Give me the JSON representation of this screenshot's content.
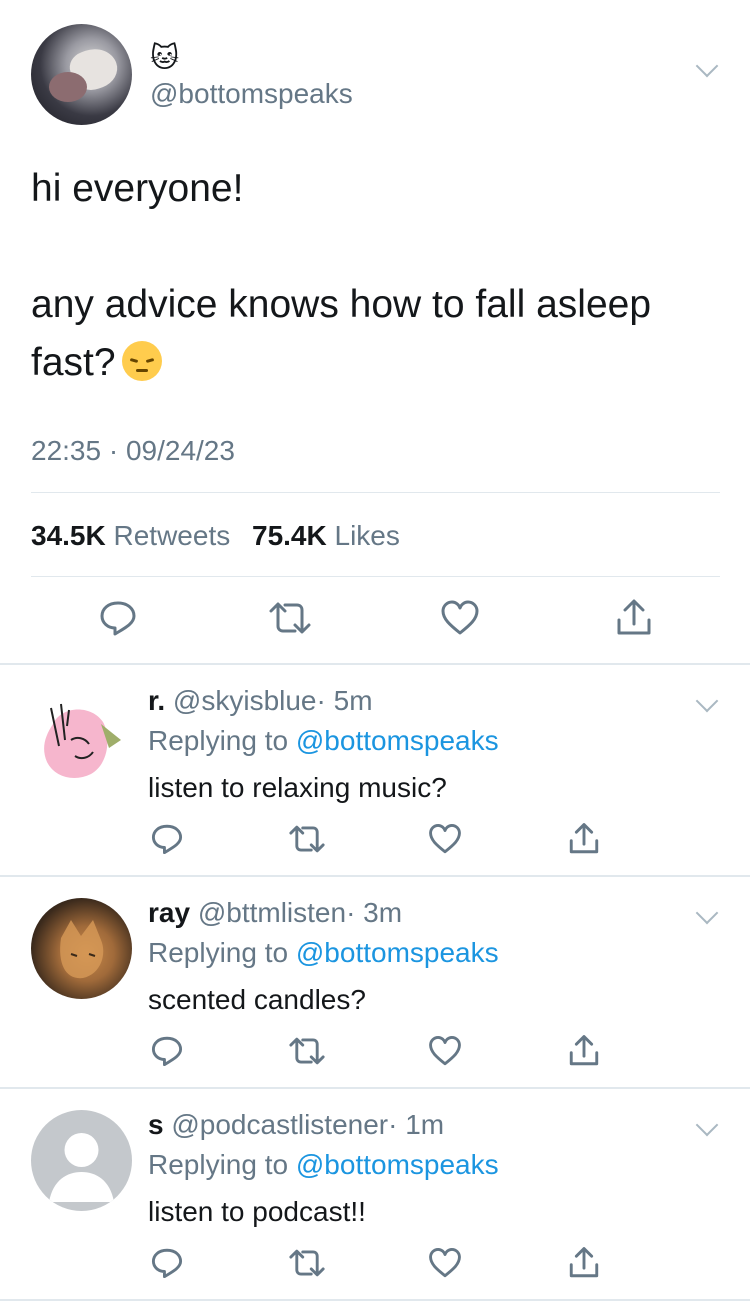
{
  "tweet": {
    "name_emoji": "🐱",
    "handle": "@bottomspeaks",
    "text_line1": "hi everyone!",
    "text_line2": "any advice knows how to fall asleep fast?",
    "text_emoji": "😔",
    "time": "22:35 · 09/24/23",
    "retweets_count": "34.5K",
    "retweets_label": "Retweets",
    "likes_count": "75.4K",
    "likes_label": "Likes"
  },
  "replies": [
    {
      "name": "r.",
      "handle": "@skyisblue",
      "time": "· 5m",
      "replying_prefix": "Replying to",
      "replying_to": "@bottomspeaks",
      "text": "listen to relaxing music?"
    },
    {
      "name": "ray",
      "handle": "@bttmlisten",
      "time": "· 3m",
      "replying_prefix": "Replying to",
      "replying_to": "@bottomspeaks",
      "text": "scented candles?"
    },
    {
      "name": "s",
      "handle": "@podcastlistener",
      "time": "· 1m",
      "replying_prefix": "Replying to",
      "replying_to": "@bottomspeaks",
      "text": "listen to podcast!!"
    }
  ],
  "icons": {
    "reply": "reply-icon",
    "retweet": "retweet-icon",
    "like": "heart-icon",
    "share": "share-icon",
    "more": "chevron-down-icon"
  },
  "colors": {
    "text": "#14171a",
    "secondary": "#657786",
    "link": "#1b95e0",
    "divider": "#e1e8ed"
  }
}
